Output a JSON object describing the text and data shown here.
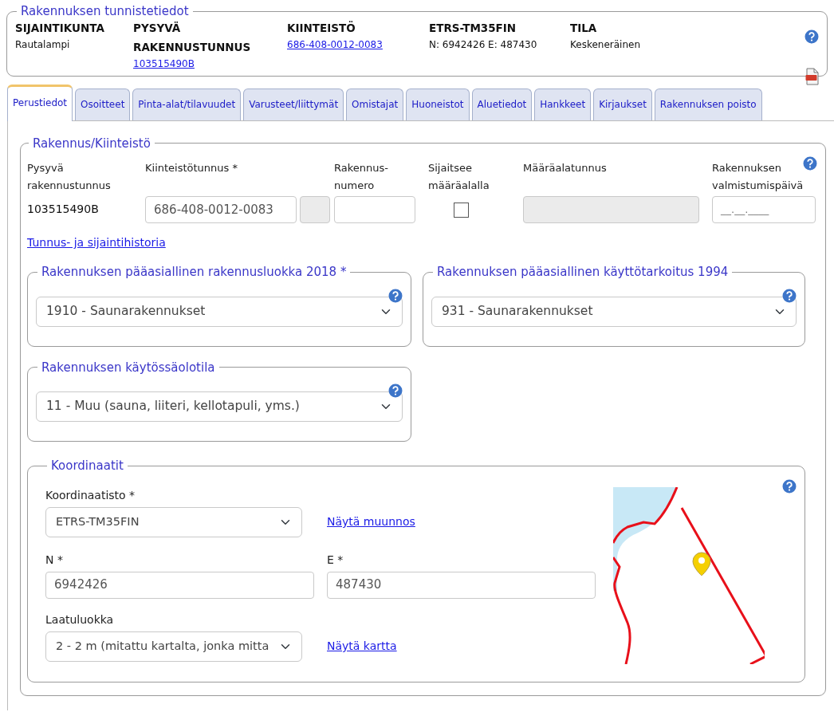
{
  "header": {
    "legend": "Rakennuksen tunnistetiedot",
    "fields": [
      {
        "label": "SIJAINTIKUNTA",
        "value": "Rautalampi",
        "kind": "text"
      },
      {
        "label": "PYSYVÄ RAKENNUSTUNNUS",
        "value": "103515490B",
        "kind": "link"
      },
      {
        "label": "KIINTEISTÖ",
        "value": "686-408-0012-0083",
        "kind": "link"
      },
      {
        "label": "ETRS-TM35FIN",
        "value": "N: 6942426 E: 487430",
        "kind": "text"
      },
      {
        "label": "TILA",
        "value": "Keskeneräinen",
        "kind": "text"
      }
    ]
  },
  "tabs": [
    {
      "label": "Perustiedot",
      "selected": true
    },
    {
      "label": "Osoitteet",
      "selected": false
    },
    {
      "label": "Pinta-alat/tilavuudet",
      "selected": false
    },
    {
      "label": "Varusteet/liittymät",
      "selected": false
    },
    {
      "label": "Omistajat",
      "selected": false
    },
    {
      "label": "Huoneistot",
      "selected": false
    },
    {
      "label": "Aluetiedot",
      "selected": false
    },
    {
      "label": "Hankkeet",
      "selected": false
    },
    {
      "label": "Kirjaukset",
      "selected": false
    },
    {
      "label": "Rakennuksen poisto",
      "selected": false
    }
  ],
  "building": {
    "legend": "Rakennus/Kiinteistö",
    "fields": [
      {
        "label": "Pysyvä rakennustunnus",
        "kind": "text",
        "value": "103515490B"
      },
      {
        "label": "Kiinteistötunnus *",
        "kind": "property",
        "value": "686-408-0012-0083"
      },
      {
        "label": "Rakennus-numero",
        "kind": "input"
      },
      {
        "label": "Sijaitsee määräalalla",
        "kind": "checkbox",
        "checked": false
      },
      {
        "label": "Määräalatunnus",
        "kind": "disabled"
      },
      {
        "label": "Rakennuksen valmistumispäivä",
        "kind": "date",
        "placeholder": "__.__.____"
      }
    ],
    "history_link": "Tunnus- ja sijaintihistoria",
    "classifications": [
      {
        "legend": "Rakennuksen pääasiallinen rakennusluokka 2018 *",
        "value": "1910 - Saunarakennukset"
      },
      {
        "legend": "Rakennuksen pääasiallinen käyttötarkoitus 1994",
        "value": "931 - Saunarakennukset"
      },
      {
        "legend": "Rakennuksen käytössäolotila",
        "value": "11 - Muu (sauna, liiteri, kellotapuli, yms.)"
      }
    ],
    "coordinates": {
      "legend": "Koordinaatit",
      "system": {
        "label": "Koordinaatisto *",
        "value": "ETRS-TM35FIN",
        "link": "Näytä muunnos"
      },
      "n": {
        "label": "N *",
        "value": "6942426"
      },
      "e": {
        "label": "E *",
        "value": "487430"
      },
      "quality": {
        "label": "Laatuluokka",
        "value": "2 - 2 m (mitattu kartalta, jonka mitta",
        "link": "Näytä kartta"
      }
    }
  }
}
